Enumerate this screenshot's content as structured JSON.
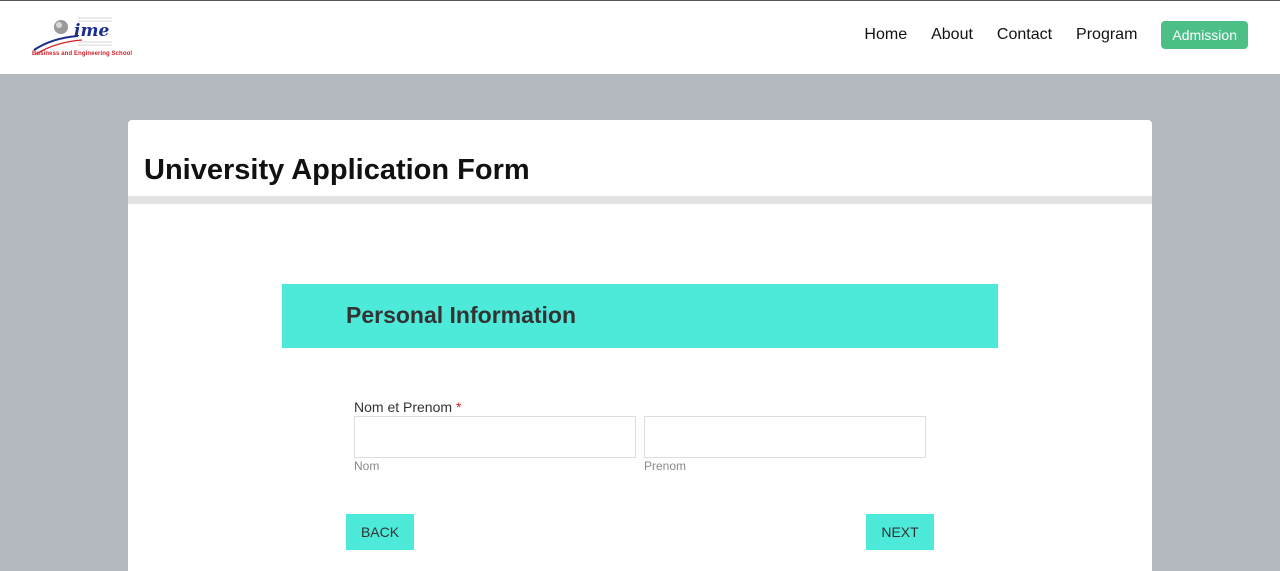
{
  "logo": {
    "text": "ime",
    "tagline": "Business and Engineering School"
  },
  "nav": {
    "items": [
      "Home",
      "About",
      "Contact",
      "Program"
    ],
    "cta": "Admission",
    "cta_color": "#4cbf86"
  },
  "form": {
    "title": "University Application Form",
    "section_title": "Personal Information",
    "section_color": "#4deada",
    "field_label": "Nom et Prenom",
    "required_mark": "*",
    "nom_value": "",
    "nom_sublabel": "Nom",
    "prenom_value": "",
    "prenom_sublabel": "Prenom",
    "back_label": "BACK",
    "next_label": "NEXT"
  }
}
